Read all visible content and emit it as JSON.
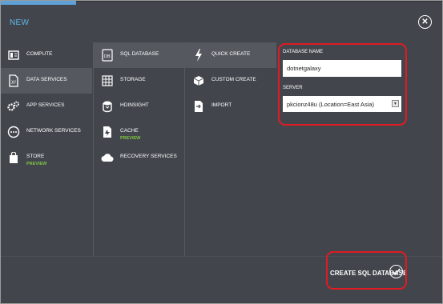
{
  "header": {
    "title": "NEW",
    "close_icon": "close-icon"
  },
  "categories": [
    {
      "label": "COMPUTE",
      "icon": "compute-icon",
      "badge": ""
    },
    {
      "label": "DATA SERVICES",
      "icon": "data-services-icon",
      "badge": ""
    },
    {
      "label": "APP SERVICES",
      "icon": "app-services-icon",
      "badge": ""
    },
    {
      "label": "NETWORK SERVICES",
      "icon": "network-services-icon",
      "badge": ""
    },
    {
      "label": "STORE",
      "icon": "store-icon",
      "badge": "PREVIEW"
    }
  ],
  "services": [
    {
      "label": "SQL DATABASE",
      "icon": "sql-database-icon",
      "badge": ""
    },
    {
      "label": "STORAGE",
      "icon": "storage-icon",
      "badge": ""
    },
    {
      "label": "HDINSIGHT",
      "icon": "hdinsight-icon",
      "badge": ""
    },
    {
      "label": "CACHE",
      "icon": "cache-icon",
      "badge": "PREVIEW"
    },
    {
      "label": "RECOVERY SERVICES",
      "icon": "recovery-services-icon",
      "badge": ""
    }
  ],
  "create_options": [
    {
      "label": "QUICK CREATE",
      "icon": "lightning-icon"
    },
    {
      "label": "CUSTOM CREATE",
      "icon": "cube-icon"
    },
    {
      "label": "IMPORT",
      "icon": "import-icon"
    }
  ],
  "form": {
    "db_name_label": "DATABASE NAME",
    "db_name_value": "dotnetgalaxy",
    "server_label": "SERVER",
    "server_value": "pkcionz48u (Location=East Asia)"
  },
  "footer": {
    "create_label": "CREATE SQL DATABASE"
  },
  "colors": {
    "background": "#42464c",
    "accent": "#5fb6ea",
    "preview": "#7ec443",
    "highlight": "#e01b24"
  }
}
